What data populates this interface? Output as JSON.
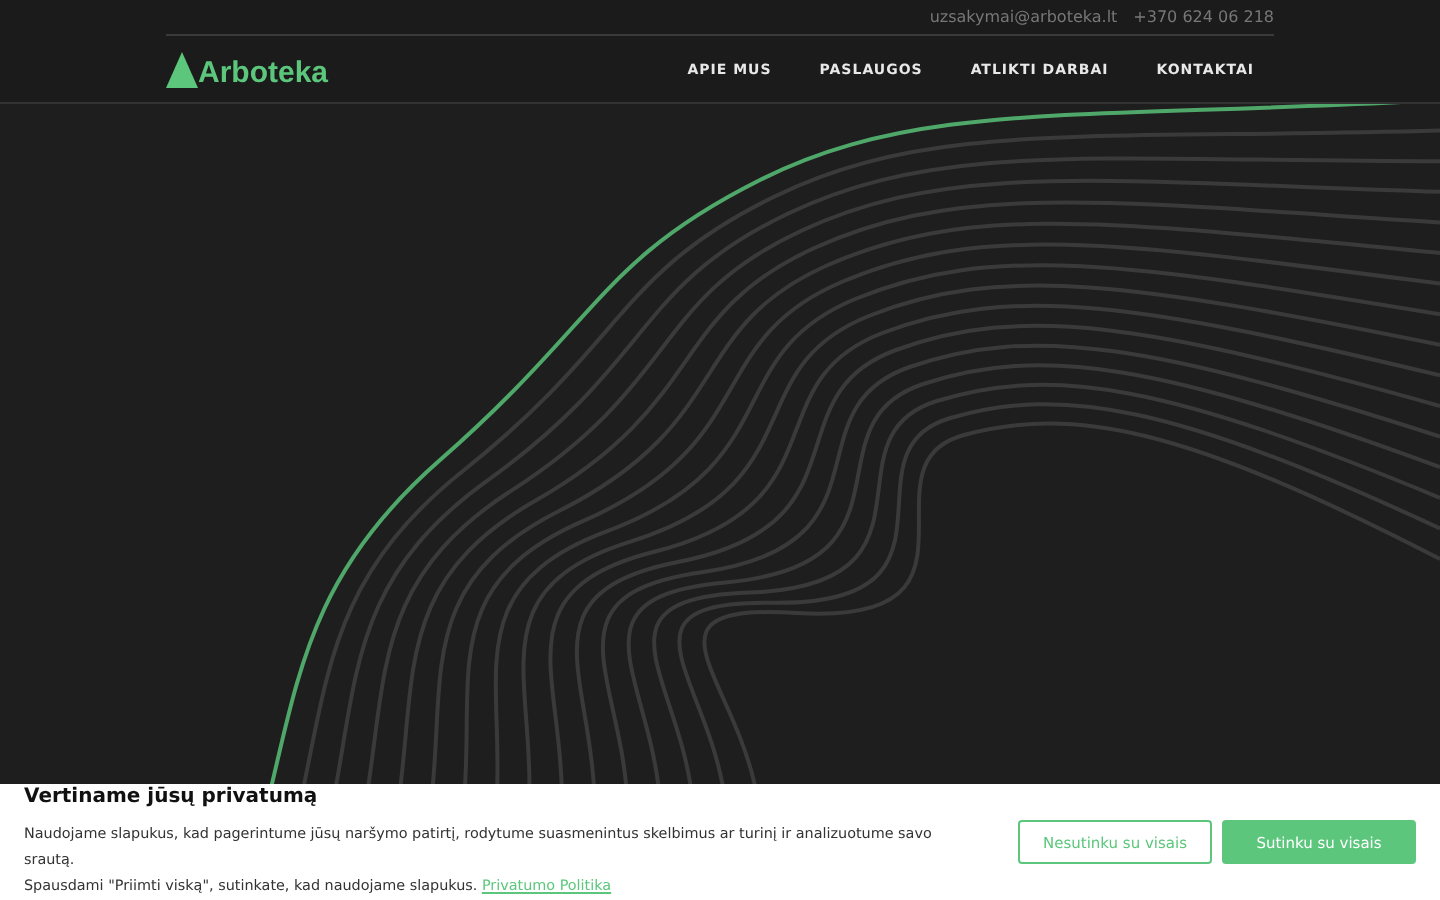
{
  "header": {
    "contacts": [
      "uzsakymai@arboteka.lt",
      "+370 624 06 218"
    ],
    "logo": "Arboteka",
    "nav": [
      "APIE MUS",
      "PASLAUGOS",
      "ATLIKTI DARBAI",
      "KONTAKTAI"
    ]
  },
  "cookie_banner": {
    "title": "Vertiname jūsų privatumą",
    "text_line_1": "Naudojame slapukus, kad pagerintume jūsų naršymo patirtį, rodytume suasmenintus skelbimus ar turinį ir analizuotume savo srautą.",
    "text_line_2": "Spausdami \"Priimti viską\", sutinkate, kad naudojame slapukus.",
    "link": "Privatumo Politika",
    "buttons": [
      {
        "label": "Nesutinku su visais",
        "kind": "outline"
      },
      {
        "label": "Sutinku su visais",
        "kind": "filled"
      }
    ]
  }
}
